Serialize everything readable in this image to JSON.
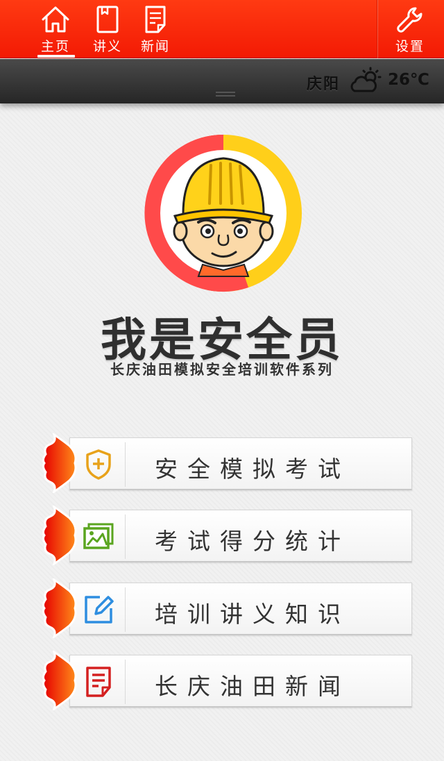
{
  "nav": {
    "tabs": [
      {
        "label": "主页",
        "icon": "home-icon",
        "active": true
      },
      {
        "label": "讲义",
        "icon": "book-icon"
      },
      {
        "label": "新闻",
        "icon": "news-icon"
      }
    ],
    "settings_label": "设置",
    "settings_icon": "wrench-icon"
  },
  "weather": {
    "city": "庆阳",
    "temperature": "26℃",
    "icon": "partly-cloudy-icon"
  },
  "app": {
    "title": "我是安全员",
    "subtitle": "长庆油田模拟安全培训软件系列"
  },
  "menu": [
    {
      "label": "安全模拟考试",
      "icon": "shield-plus-icon",
      "color": "#e8a21a"
    },
    {
      "label": "考试得分统计",
      "icon": "image-chart-icon",
      "color": "#5aa51f"
    },
    {
      "label": "培训讲义知识",
      "icon": "edit-icon",
      "color": "#2e8ee0"
    },
    {
      "label": "长庆油田新闻",
      "icon": "document-icon",
      "color": "#d42020"
    }
  ],
  "colors": {
    "accent_red": "#f31a04",
    "bar_dark": "#262626"
  }
}
